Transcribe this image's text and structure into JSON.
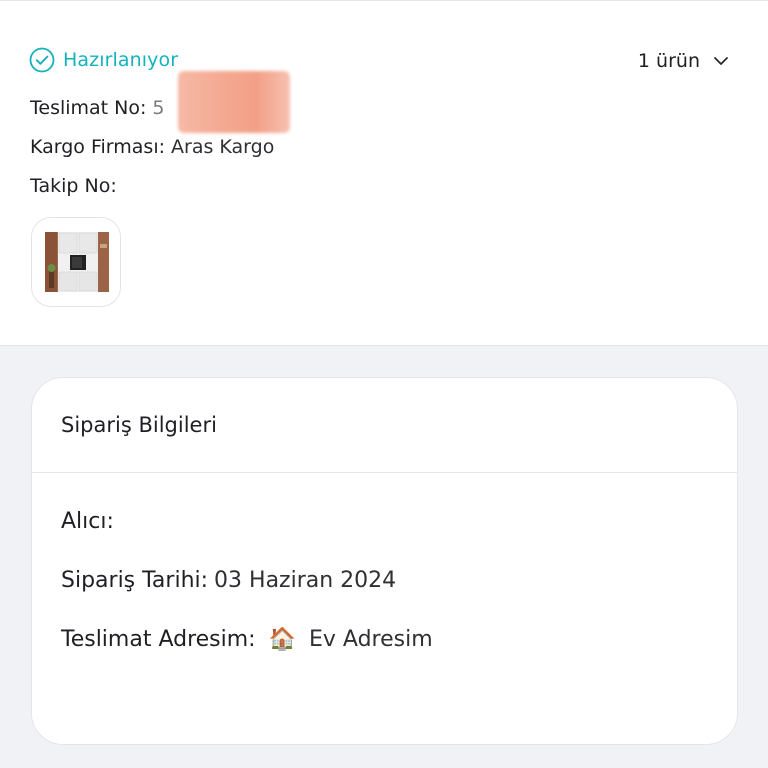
{
  "shipment": {
    "status": "Hazırlanıyor",
    "status_icon": "check-circle-icon",
    "item_count": "1 ürün",
    "delivery_no_label": "Teslimat No:",
    "delivery_no_value": "5",
    "cargo_label": "Kargo Firması:",
    "cargo_value": "Aras Kargo",
    "tracking_label": "Takip No:",
    "tracking_value": "",
    "accent_color": "#13b3bd"
  },
  "order_info": {
    "title": "Sipariş Bilgileri",
    "recipient_label": "Alıcı:",
    "recipient_value": "",
    "date_label": "Sipariş Tarihi:",
    "date_value": "03 Haziran 2024",
    "address_label": "Teslimat Adresim:",
    "address_icon": "🏠",
    "address_value": "Ev Adresim"
  }
}
